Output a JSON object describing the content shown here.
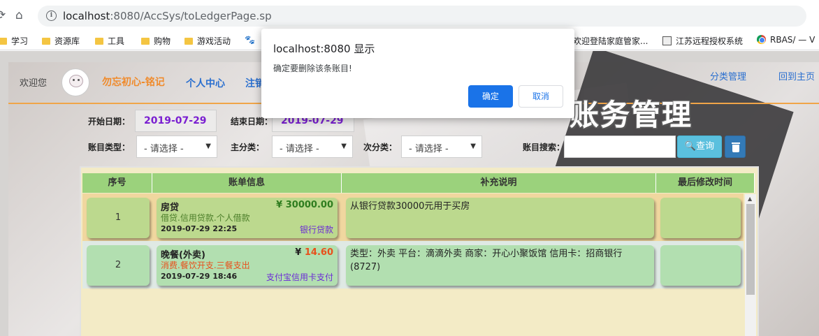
{
  "browser": {
    "url_host": "localhost",
    "url_rest": ":8080/AccSys/toLedgerPage.sp",
    "bookmarks": [
      {
        "label": "学习",
        "icon": "folder-icon"
      },
      {
        "label": "资源库",
        "icon": "folder-icon"
      },
      {
        "label": "工具",
        "icon": "folder-icon"
      },
      {
        "label": "购物",
        "icon": "folder-icon"
      },
      {
        "label": "游戏活动",
        "icon": "folder-icon"
      },
      {
        "label": "欢迎登陆家庭管家...",
        "icon": "page-icon"
      },
      {
        "label": "江苏远程授权系统",
        "icon": "document-icon"
      },
      {
        "label": "RBAS/ — V",
        "icon": "chrome-icon"
      }
    ]
  },
  "header": {
    "welcome": "欢迎您",
    "username": "勿忘初心-铭记",
    "personal_center": "个人中心",
    "logout": "注销",
    "category_manage": "分类管理",
    "back_home": "回到主页",
    "title": "账务管理"
  },
  "filters": {
    "start_label": "开始日期：",
    "start_date": "2019-07-29",
    "end_label": "结束日期：",
    "end_date": "2019-07-29",
    "type_label": "账目类型：",
    "type_value": "- 请选择 -",
    "main_label": "主分类：",
    "main_value": "- 请选择 -",
    "sub_label": "次分类：",
    "sub_value": "- 请选择 -",
    "search_label": "账目搜索：",
    "search_value": "",
    "search_button": "查询"
  },
  "table": {
    "headers": [
      "序号",
      "账单信息",
      "补充说明",
      "最后修改时间"
    ],
    "rows": [
      {
        "index": "1",
        "name": "房贷",
        "amount": "¥ 30000.00",
        "category": "借贷.信用贷款.个人借款",
        "time": "2019-07-29 22:25",
        "payment": "银行贷款",
        "note": "从银行贷款30000元用于买房",
        "modified": "",
        "amount_color": "#2f7d1f",
        "category_color": "#4d7f2a"
      },
      {
        "index": "2",
        "name": "晚餐(外卖)",
        "amount_prefix": "¥ ",
        "amount": "14.60",
        "category": "消费.餐饮开支.三餐支出",
        "time": "2019-07-29 18:46",
        "payment": "支付宝信用卡支付",
        "note": "类型：外卖 平台：滴滴外卖 商家：开心小聚饭馆 信用卡：招商银行(8727)",
        "modified": "",
        "amount_color": "#e8501c",
        "category_color": "#e8501c"
      }
    ]
  },
  "dialog": {
    "title": "localhost:8080 显示",
    "message": "确定要删除该条账目!",
    "ok": "确定",
    "cancel": "取消"
  }
}
